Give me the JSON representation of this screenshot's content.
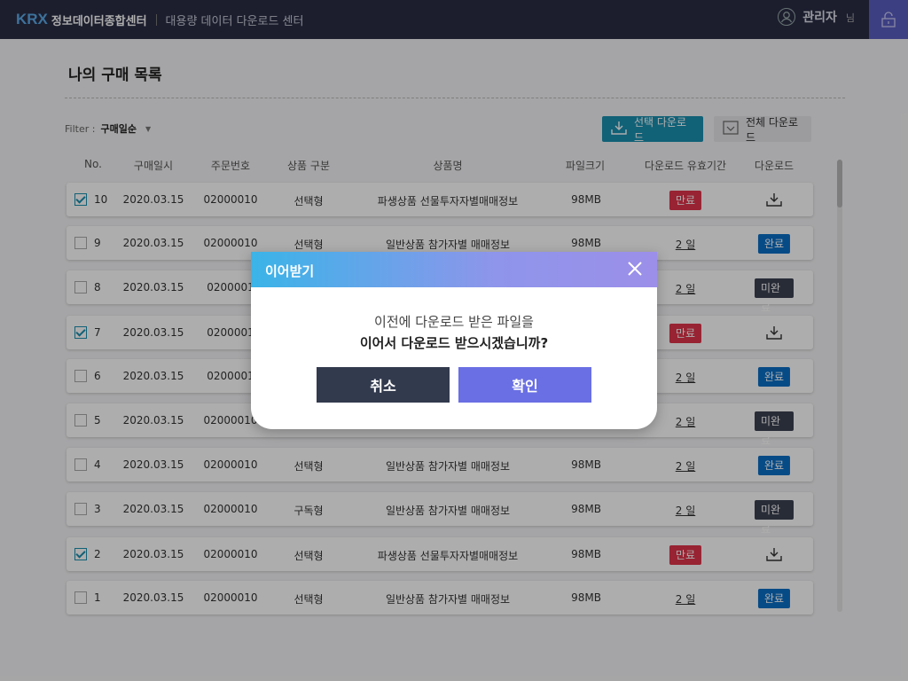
{
  "header": {
    "logo_mark": "KRX",
    "logo_text": "정보데이터종합센터",
    "service_name": "대용량 데이터 다운로드 센터",
    "user_name": "관리자",
    "user_suffix": "님"
  },
  "page": {
    "title": "나의 구매 목록",
    "filter_label": "Filter :",
    "filter_value": "구매일순",
    "btn_selected_download": "선택 다운로드",
    "btn_all_download": "전체 다운로드"
  },
  "table": {
    "columns": [
      "No.",
      "구매일시",
      "주문번호",
      "상품 구분",
      "상품명",
      "파일크기",
      "다운로드 유효기간",
      "다운로드"
    ],
    "rows": [
      {
        "checked": true,
        "no": "10",
        "date": "2020.03.15",
        "order": "02000010",
        "type": "선택형",
        "name": "파생상품 선물투자자별매매정보",
        "size": "98MB",
        "period": "만료",
        "download": "icon"
      },
      {
        "checked": false,
        "no": "9",
        "date": "2020.03.15",
        "order": "02000010",
        "type": "선택형",
        "name": "일반상품 참가자별 매매정보",
        "size": "98MB",
        "period": "2 일",
        "download": "완료"
      },
      {
        "checked": false,
        "no": "8",
        "date": "2020.03.15",
        "order": "0200001",
        "type": "",
        "name": "",
        "size": "",
        "period": "2 일",
        "download": "미완료"
      },
      {
        "checked": true,
        "no": "7",
        "date": "2020.03.15",
        "order": "0200001",
        "type": "",
        "name": "",
        "size": "",
        "period": "만료",
        "download": "icon"
      },
      {
        "checked": false,
        "no": "6",
        "date": "2020.03.15",
        "order": "0200001",
        "type": "",
        "name": "",
        "size": "",
        "period": "2 일",
        "download": "완료"
      },
      {
        "checked": false,
        "no": "5",
        "date": "2020.03.15",
        "order": "02000010",
        "type": "",
        "name": "",
        "size": "",
        "period": "2 일",
        "download": "미완료"
      },
      {
        "checked": false,
        "no": "4",
        "date": "2020.03.15",
        "order": "02000010",
        "type": "선택형",
        "name": "일반상품 참가자별 매매정보",
        "size": "98MB",
        "period": "2 일",
        "download": "완료"
      },
      {
        "checked": false,
        "no": "3",
        "date": "2020.03.15",
        "order": "02000010",
        "type": "구독형",
        "name": "일반상품 참가자별 매매정보",
        "size": "98MB",
        "period": "2 일",
        "download": "미완료"
      },
      {
        "checked": true,
        "no": "2",
        "date": "2020.03.15",
        "order": "02000010",
        "type": "선택형",
        "name": "파생상품 선물투자자별매매정보",
        "size": "98MB",
        "period": "만료",
        "download": "icon"
      },
      {
        "checked": false,
        "no": "1",
        "date": "2020.03.15",
        "order": "02000010",
        "type": "선택형",
        "name": "일반상품 참가자별 매매정보",
        "size": "98MB",
        "period": "2 일",
        "download": "완료"
      }
    ]
  },
  "modal": {
    "title": "이어받기",
    "message_line1": "이전에 다운로드 받은 파일을",
    "message_line2": "이어서 다운로드 받으시겠습니까?",
    "cancel_label": "취소",
    "confirm_label": "확인"
  },
  "colors": {
    "expired": "#e0344b",
    "complete": "#0b6fc6",
    "incomplete": "#3b4152",
    "accent": "#1a8fb0"
  }
}
